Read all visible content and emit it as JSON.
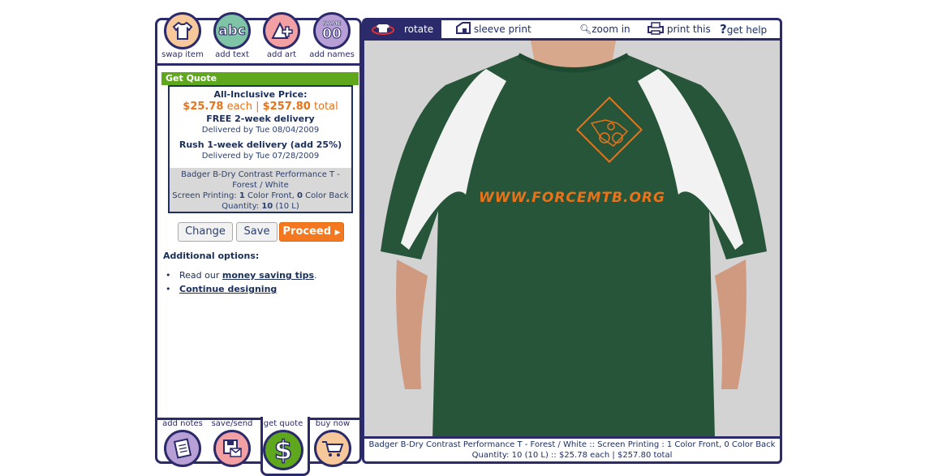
{
  "left": {
    "tools": [
      "swap item",
      "add text",
      "add art",
      "add names"
    ],
    "quote": {
      "header": "Get Quote",
      "price_label": "All-Inclusive Price:",
      "each_price": "$25.78",
      "each_label": "each",
      "separator": "|",
      "total_price": "$257.80",
      "total_label": "total",
      "free_delivery": "FREE 2-week delivery",
      "free_delivered_by": "Delivered by Tue 08/04/2009",
      "rush_delivery": "Rush 1-week delivery (add 25%)",
      "rush_delivered_by": "Delivered by Tue 07/28/2009",
      "product_line1": "Badger B-Dry Contrast Performance T -",
      "product_line2": "Forest / White",
      "printing_label": "Screen Printing:",
      "front_count": "1",
      "front_label": "Color Front,",
      "back_count": "0",
      "back_label": "Color Back",
      "quantity_label": "Quantity:",
      "quantity_value": "10",
      "quantity_detail": "(10 L)"
    },
    "buttons": {
      "change": "Change",
      "save": "Save",
      "proceed": "Proceed"
    },
    "options": {
      "title": "Additional options:",
      "read_prefix": "Read our",
      "money_link": "money saving tips",
      "read_suffix": ".",
      "continue_link": "Continue designing"
    },
    "bottom_tools": [
      "add notes",
      "save/send",
      "get quote",
      "buy now"
    ]
  },
  "right": {
    "toolbar": {
      "rotate": "rotate",
      "sleeve": "sleeve print",
      "zoom": "zoom in",
      "print": "print this",
      "help": "get help"
    },
    "design": {
      "logo_text": "WWW.FORCEMTB.ORG"
    },
    "summary_line1": "Badger B-Dry Contrast Performance T - Forest / White :: Screen Printing : 1 Color Front, 0 Color Back",
    "summary_line2": "Quantity: 10 (10 L) :: $25.78 each | $257.80 total"
  },
  "colors": {
    "navy": "#2b2a6a",
    "green": "#5fa81e",
    "orange": "#f47820",
    "shirt": "#27553a"
  }
}
